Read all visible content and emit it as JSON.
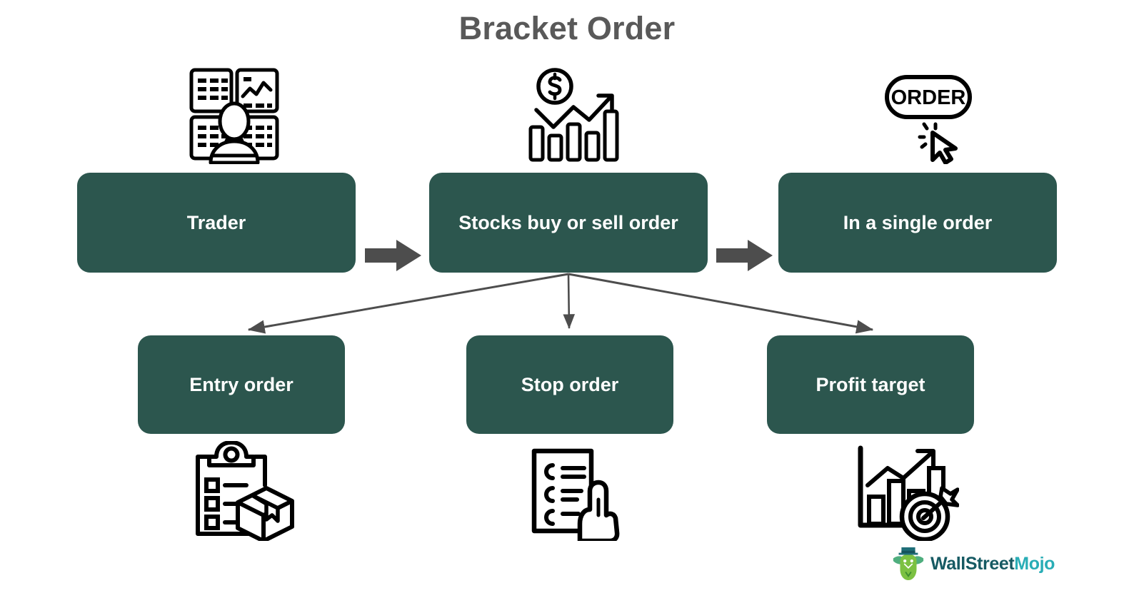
{
  "title": "Bracket Order",
  "theme": {
    "box_fill": "#2C564E",
    "box_text": "#FFFFFF",
    "title_color": "#595959",
    "arrow_color": "#4D4D4D",
    "connector_color": "#4D4D4D",
    "background": "#FFFFFF",
    "logo_primary": "#165A63",
    "logo_accent": "#29ADB6",
    "logo_bull_green": "#6FBE44",
    "logo_hat_teal": "#1F6E78"
  },
  "flow": {
    "top_row": [
      {
        "id": "trader",
        "label": "Trader",
        "icon": "trader-screens-icon"
      },
      {
        "id": "stocks",
        "label": "Stocks buy or sell order",
        "icon": "stock-growth-chart-icon"
      },
      {
        "id": "single",
        "label": "In a single order",
        "icon": "order-button-click-icon"
      }
    ],
    "bottom_row": [
      {
        "id": "entry",
        "label": "Entry order",
        "icon": "clipboard-package-icon"
      },
      {
        "id": "stop",
        "label": "Stop order",
        "icon": "checklist-hand-tap-icon"
      },
      {
        "id": "profit",
        "label": "Profit target",
        "icon": "bar-chart-target-icon"
      }
    ],
    "block_arrows": [
      {
        "id": "trader-to-stocks",
        "from": "trader",
        "to": "stocks",
        "style": "block-arrow-right"
      },
      {
        "id": "stocks-to-single",
        "from": "stocks",
        "to": "single",
        "style": "block-arrow-right"
      }
    ],
    "connectors": [
      {
        "id": "stocks-to-entry",
        "from": "stocks",
        "to": "entry",
        "style": "line-arrow"
      },
      {
        "id": "stocks-to-stop",
        "from": "stocks",
        "to": "stop",
        "style": "line-arrow"
      },
      {
        "id": "stocks-to-profit",
        "from": "stocks",
        "to": "profit",
        "style": "line-arrow"
      }
    ]
  },
  "icons": {
    "order_button_text": "ORDER"
  },
  "logo": {
    "name_primary": "WallStreet",
    "name_accent": "Mojo",
    "mark": "bull-with-top-hat-icon"
  }
}
